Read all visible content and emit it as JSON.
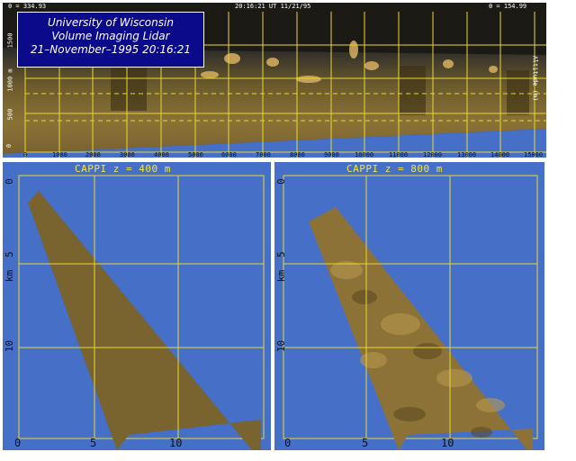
{
  "top_panel": {
    "header_left": "θ = 334.93",
    "header_center": "20:16:21 UT 11/21/95",
    "header_right": "θ = 154.99",
    "title_lines": [
      "University of Wisconsin",
      "Volume Imaging Lidar",
      "21–November–1995 20:16:21"
    ],
    "y_ticks": [
      "0",
      "500",
      "1000 m",
      "1500"
    ],
    "right_axis_label": "Altitude (m)",
    "x_ticks": [
      "0",
      "1000",
      "2000",
      "3000",
      "4000",
      "5000",
      "6000",
      "7000",
      "8000",
      "9000",
      "10000",
      "11000",
      "12000",
      "13000",
      "14000",
      "15000"
    ]
  },
  "left_panel": {
    "title": "CAPPI   z = 400 m",
    "y_ticks": [
      "0",
      "5",
      "10"
    ],
    "y_unit": "km",
    "x_ticks": [
      "0",
      "5",
      "10"
    ]
  },
  "right_panel": {
    "title": "CAPPI   z = 800 m",
    "y_ticks": [
      "0",
      "5",
      "10"
    ],
    "y_unit": "km",
    "x_ticks": [
      "0",
      "5",
      "10"
    ]
  },
  "colors": {
    "background_blue": "#4670c8",
    "grid_yellow": "#e8d830",
    "aerosol_dark": "#5a4a24",
    "aerosol_bright": "#c8a050",
    "title_navy": "#0a0a8a"
  }
}
